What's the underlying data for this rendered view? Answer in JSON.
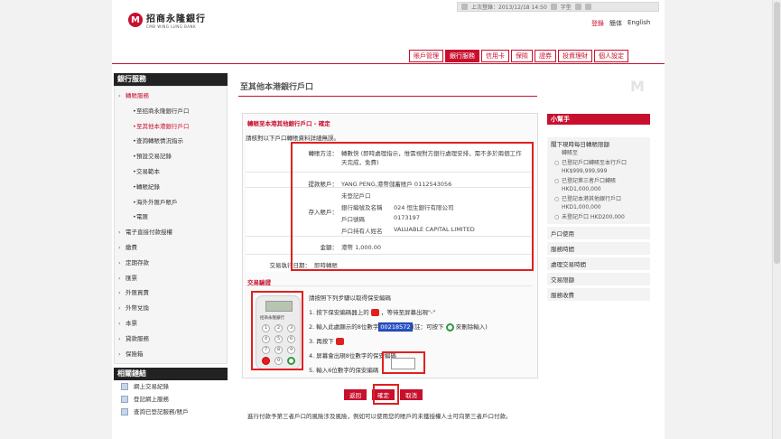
{
  "header": {
    "logo_mark": "M",
    "logo_zh": "招商永隆銀行",
    "logo_en": "CMB WING LUNG BANK",
    "last_login": "上次登錄：2013/12/18 14:50",
    "font_size_label": "字型",
    "links": [
      "登錄",
      "簡体",
      "English"
    ],
    "logout_label": "登錄"
  },
  "nav": {
    "tabs": [
      "賬戶管理",
      "銀行服務",
      "信用卡",
      "保險",
      "證券",
      "投資理財",
      "個人設定"
    ],
    "active_index": 1
  },
  "sidebar": {
    "title": "銀行服務",
    "items": [
      {
        "label": "轉賬服務",
        "level": "top",
        "open": true
      },
      {
        "label": "至招商永隆銀行戶口",
        "level": "sub"
      },
      {
        "label": "至其他本港銀行戶口",
        "level": "sub",
        "active": true
      },
      {
        "label": "查詢轉賬情況指示",
        "level": "sub"
      },
      {
        "label": "預設交易記錄",
        "level": "sub"
      },
      {
        "label": "交易範本",
        "level": "sub"
      },
      {
        "label": "轉賬紀錄",
        "level": "sub"
      },
      {
        "label": "海外外匯戶賬戶",
        "level": "sub"
      },
      {
        "label": "電匯",
        "level": "sub"
      },
      {
        "label": "電子直接付款授權",
        "level": "top"
      },
      {
        "label": "繳費",
        "level": "top"
      },
      {
        "label": "定期存款",
        "level": "top"
      },
      {
        "label": "匯票",
        "level": "top"
      },
      {
        "label": "外匯買賣",
        "level": "top"
      },
      {
        "label": "外幣兌換",
        "level": "top"
      },
      {
        "label": "本票",
        "level": "top"
      },
      {
        "label": "貸款服務",
        "level": "top"
      },
      {
        "label": "保險箱",
        "level": "top"
      }
    ],
    "related_title": "相關鏈結",
    "related": [
      "網上交易紀錄",
      "登記網上服務",
      "查詢已登記服務/賬戶"
    ]
  },
  "main": {
    "page_title": "至其他本港銀行戶口",
    "box_title": "轉賬至本港其他銀行戶口 - 確定",
    "box_subtitle": "請核對以下戶口轉賬資料詳細無誤。",
    "transfer_method_label": "轉賬方法：",
    "transfer_method_value": "轉數快 (即時處理指示，惟需視對方銀行處理安排，需不多於兩個工作天完成，免費)",
    "debit_account_label": "提款賬戶：",
    "debit_account_value": "YANG PENG,港幣儲蓄賬戶 0112543056",
    "credit_account_label": "存入賬戶：",
    "credit_account_header": "未登記戶口",
    "credit_fields": [
      {
        "k": "銀行編號及名稱",
        "v": "024 恒生銀行有限公司"
      },
      {
        "k": "戶口號碼",
        "v": "0173197"
      },
      {
        "k": "戶口持有人姓名",
        "v": "VALUABLE CAPITAL LIMITED"
      }
    ],
    "amount_label": "金額：",
    "amount_value": "港幣 1,000.00",
    "exec_date_label": "交易執行日期：",
    "exec_date_value": "即時轉賬",
    "auth_section_title": "交易驗證",
    "token_brand": "招商永隆銀行",
    "token_keys": [
      "1",
      "2",
      "3",
      "4",
      "5",
      "6",
      "7",
      "8",
      "9",
      "",
      "0",
      ""
    ],
    "instr_title": "請按照下列步驟以取得保安編碼",
    "instr_1": "1. 按下保安編碼器上的",
    "instr_1b": "，等待至屏幕出現\"-\"",
    "instr_2a": "2. 輸入此處顯示的8位數字",
    "instr_2_code": "00218572",
    "instr_2b": "(註：可按下",
    "instr_2c": "來刪除輸入)",
    "instr_3": "3. 再按下",
    "instr_4": "4. 屏幕會出現8位數字的保安編碼",
    "instr_5": "5. 輸入6位數字的保安編碼",
    "buttons": [
      "返回",
      "確定",
      "取消"
    ],
    "notice": "進行付款予第三者戶口的風險涉及風險，例如可以使用您的賬戶的未獲授權人士可向第三者戶口付款。"
  },
  "right_panel": {
    "title": "小幫手",
    "section1": "閣下現時每日轉賬限額",
    "items1": [
      {
        "text": "轉賬至",
        "bullet": false
      },
      {
        "text": "已登記戶口轉賬至本行戶口 HK$999,999,999",
        "bullet": true
      },
      {
        "text": "已登記第三者戶口轉賬 HKD1,000,000",
        "bullet": true
      },
      {
        "text": "已登記本港其他銀行戶口 HKD1,000,000",
        "bullet": true
      },
      {
        "text": "未登記戶口 HKD200,000",
        "bullet": true
      }
    ],
    "links": [
      "戶口使用",
      "服務時間",
      "處理交易時間",
      "交易限額",
      "服務收費"
    ]
  }
}
